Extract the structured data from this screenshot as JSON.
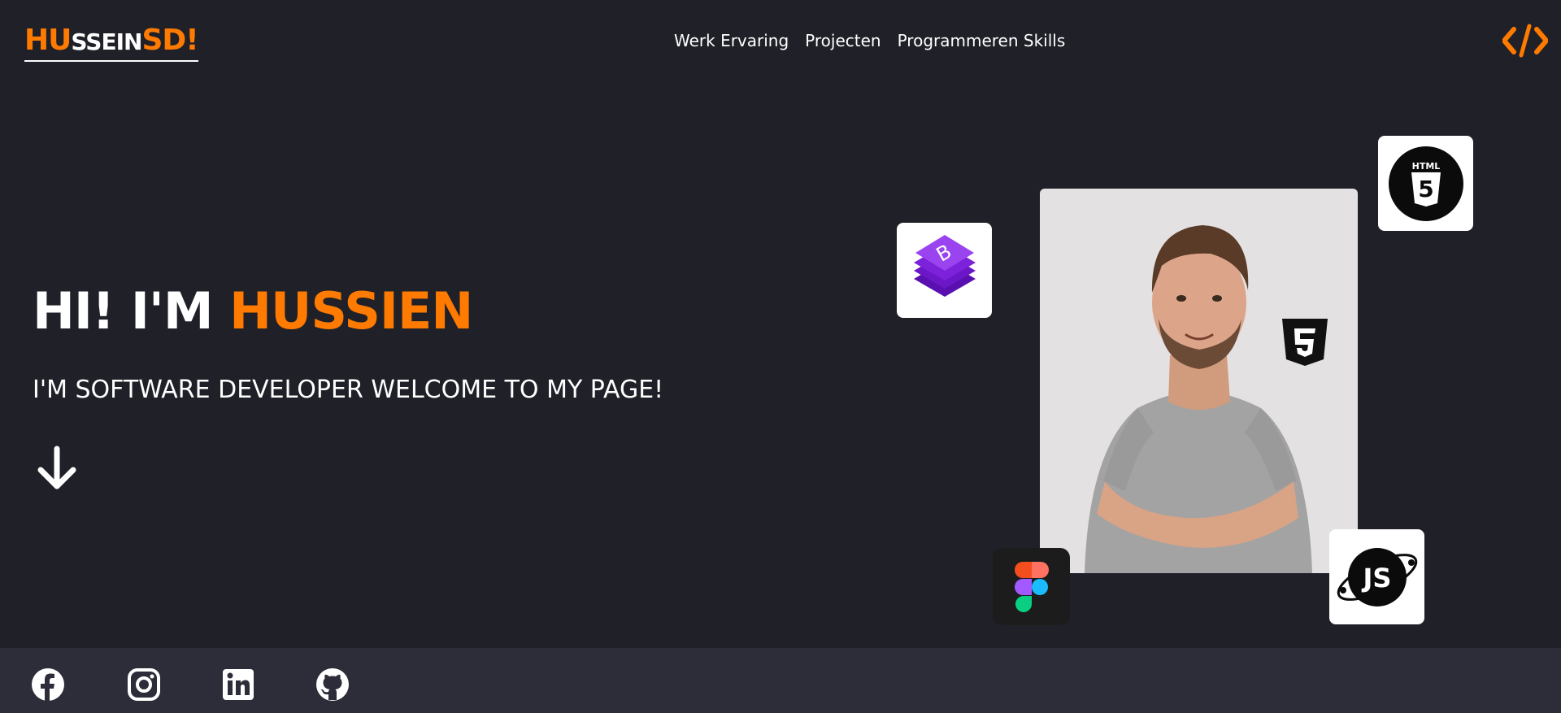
{
  "logo": {
    "part1": "HU",
    "part2": "SSEIN",
    "part3": "SD!"
  },
  "nav": {
    "items": [
      {
        "label": "Werk Ervaring"
      },
      {
        "label": "Projecten"
      },
      {
        "label": "Programmeren Skills"
      }
    ]
  },
  "hero": {
    "title_prefix": "HI! I'M ",
    "title_name": "HUSSIEN",
    "subtitle": "I'M SOFTWARE DEVELOPER WELCOME TO MY PAGE!"
  },
  "badges": {
    "html_label": "HTML",
    "html_number": "5",
    "js_label": "JS"
  },
  "colors": {
    "accent": "#ff7a00",
    "background": "#1f2028",
    "footer": "#2c2d39",
    "photo_bg": "#e3e1e2"
  },
  "icons": {
    "header_right": "code-icon",
    "scroll": "arrow-down-icon",
    "social": [
      "facebook-icon",
      "instagram-icon",
      "linkedin-icon",
      "github-icon"
    ],
    "skills": [
      "bootstrap-icon",
      "html5-icon",
      "css3-icon",
      "figma-icon",
      "javascript-icon"
    ]
  }
}
